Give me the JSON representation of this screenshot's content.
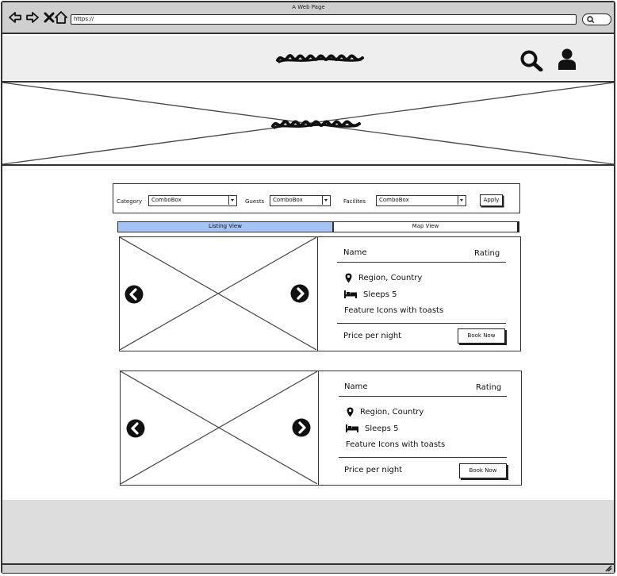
{
  "browser": {
    "window_title": "A Web Page",
    "url": "https://"
  },
  "header": {
    "logo_icon": "scribble-logo",
    "search_icon": "search-icon",
    "user_icon": "user-icon"
  },
  "hero": {
    "image_icon": "image-placeholder",
    "title_icon": "scribble-title"
  },
  "filters": {
    "category_label": "Category",
    "category_value": "ComboBox",
    "guests_label": "Guests",
    "guests_value": "ComboBox",
    "facilities_label": "Facilites",
    "facilities_value": "ComboBox",
    "apply_label": "Apply"
  },
  "tabs": {
    "listing": "Listing View",
    "map": "Map View",
    "active_color": "#a4c2f4"
  },
  "listings": [
    {
      "name": "Name",
      "rating": "Rating",
      "location": "Region, Country",
      "sleeps": "Sleeps 5",
      "features": "Feature Icons with toasts",
      "price": "Price per night",
      "book_label": "Book Now"
    },
    {
      "name": "Name",
      "rating": "Rating",
      "location": "Region, Country",
      "sleeps": "Sleeps 5",
      "features": "Feature Icons with toasts",
      "price": "Price per night",
      "book_label": "Book Now"
    }
  ]
}
